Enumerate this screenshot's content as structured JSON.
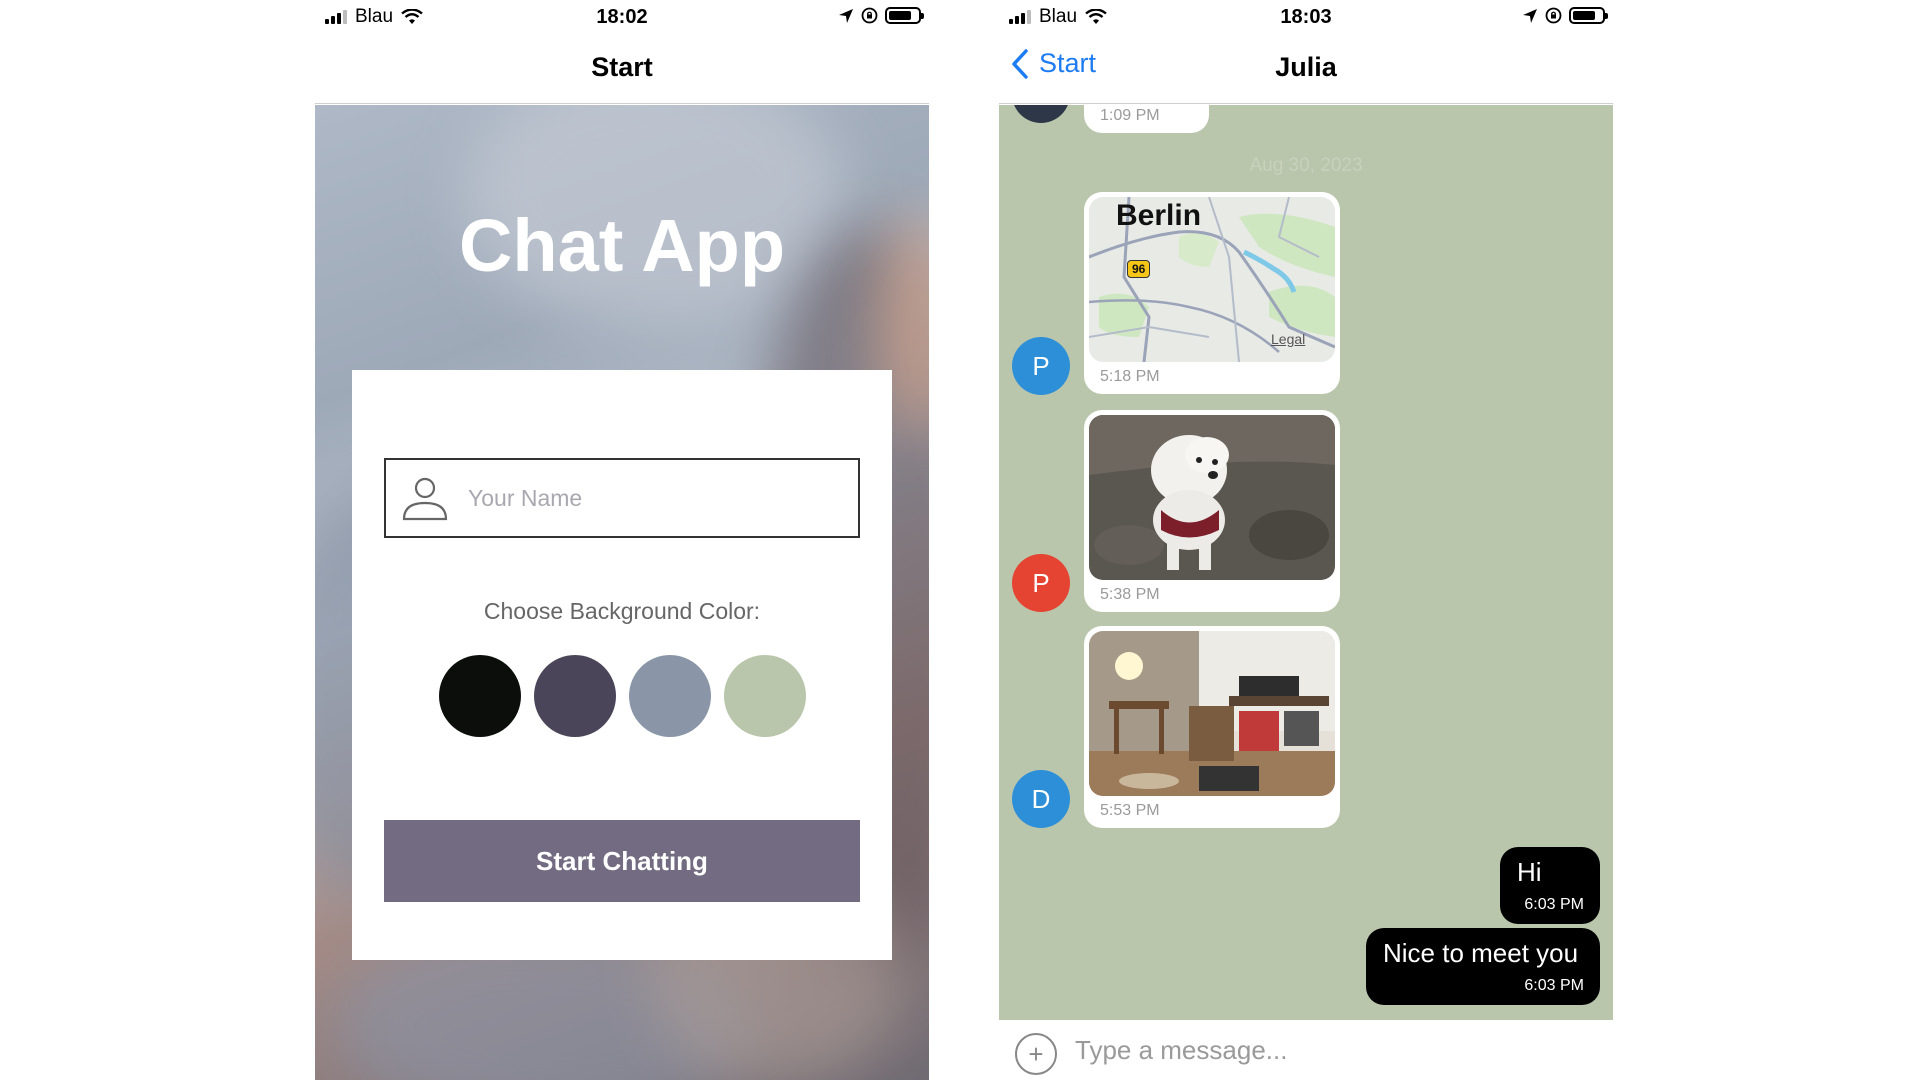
{
  "left_phone": {
    "status": {
      "carrier": "Blau",
      "time": "18:02"
    },
    "nav": {
      "title": "Start"
    },
    "app_title": "Chat App",
    "name_input": {
      "placeholder": "Your Name",
      "value": ""
    },
    "choose_label": "Choose Background Color:",
    "swatches": [
      {
        "color": "#0b0e0b"
      },
      {
        "color": "#4a4558"
      },
      {
        "color": "#8a96a8"
      },
      {
        "color": "#b9c6ab"
      }
    ],
    "start_button": "Start Chatting"
  },
  "right_phone": {
    "status": {
      "carrier": "Blau",
      "time": "18:03"
    },
    "nav": {
      "back_label": "Start",
      "title": "Julia"
    },
    "chat_background": "#b9c6ab",
    "date_separator": "Aug 30, 2023",
    "messages": [
      {
        "type": "text-partial",
        "time": "1:09 PM"
      },
      {
        "type": "location",
        "map_label": "Berlin",
        "road_badge": "96",
        "legal": "Legal",
        "time": "5:18 PM",
        "avatar": "P",
        "avatar_color": "#2d8fd8"
      },
      {
        "type": "image",
        "subject": "white dog",
        "time": "5:38 PM",
        "avatar": "P",
        "avatar_color": "#e64433"
      },
      {
        "type": "image",
        "subject": "room",
        "time": "5:53 PM",
        "avatar": "D",
        "avatar_color": "#2d8fd8"
      },
      {
        "type": "text",
        "text": "Hi",
        "time": "6:03 PM",
        "own": true
      },
      {
        "type": "text",
        "text": "Nice to meet you",
        "time": "6:03 PM",
        "own": true
      }
    ],
    "input": {
      "placeholder": "Type a message..."
    }
  }
}
